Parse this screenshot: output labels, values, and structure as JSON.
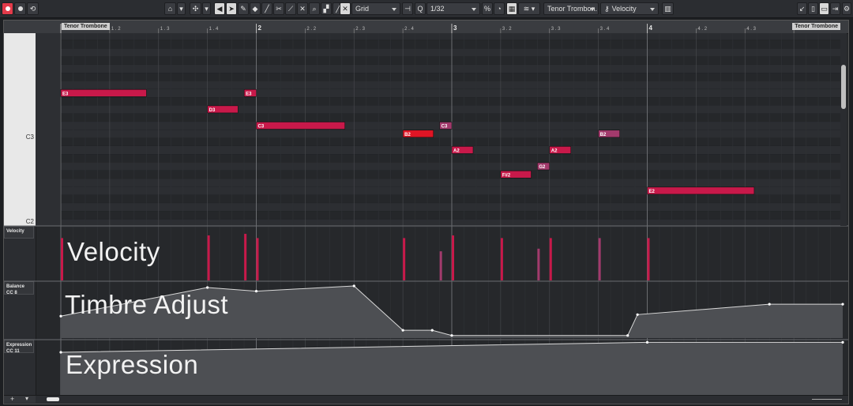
{
  "toolbar": {
    "snap_type": "Grid",
    "quantize": "1/32",
    "track_select": "Tenor Trombon.",
    "lane_select": "Velocity"
  },
  "track_name": "Tenor Trombone",
  "ruler": {
    "bars": [
      "2",
      "3",
      "4"
    ],
    "beats": [
      "1 . 2",
      "1 . 3",
      "1 . 4",
      "2 . 2",
      "2 . 3",
      "2 . 4",
      "3 . 2",
      "3 . 3",
      "3 . 4",
      "4 . 2",
      "4 . 3",
      "4 . 4"
    ]
  },
  "keyboard": {
    "label_c3": "C3",
    "label_c2": "C2"
  },
  "notes": [
    {
      "pitch": "E3",
      "start": 1.0,
      "end": 1.438,
      "velocity": 0.8
    },
    {
      "pitch": "D3",
      "start": 1.75,
      "end": 1.906,
      "velocity": 0.85
    },
    {
      "pitch": "E3",
      "start": 1.938,
      "end": 2.0,
      "velocity": 0.88
    },
    {
      "pitch": "C3",
      "start": 2.0,
      "end": 2.453,
      "velocity": 0.8
    },
    {
      "pitch": "B2",
      "start": 2.75,
      "end": 2.906,
      "velocity": 0.8
    },
    {
      "pitch": "C3",
      "start": 2.938,
      "end": 3.0,
      "velocity": 0.55,
      "muted": true
    },
    {
      "pitch": "A2",
      "start": 3.0,
      "end": 3.109,
      "velocity": 0.85
    },
    {
      "pitch": "F#2",
      "start": 3.25,
      "end": 3.406,
      "velocity": 0.8
    },
    {
      "pitch": "G2",
      "start": 3.438,
      "end": 3.5,
      "velocity": 0.6,
      "muted": true
    },
    {
      "pitch": "A2",
      "start": 3.5,
      "end": 3.609,
      "velocity": 0.8
    },
    {
      "pitch": "B2",
      "start": 3.75,
      "end": 3.859,
      "velocity": 0.8,
      "muted": true
    },
    {
      "pitch": "E2",
      "start": 4.0,
      "end": 4.547,
      "velocity": 0.8
    }
  ],
  "velocity_lane": {
    "label": "Velocity",
    "title": "Velocity"
  },
  "balance_lane": {
    "label": "Balance",
    "sublabel": "CC 8",
    "title": "Timbre Adjust",
    "points": [
      [
        1.0,
        0.58
      ],
      [
        1.75,
        0.03
      ],
      [
        2.0,
        0.1
      ],
      [
        2.5,
        0.0
      ],
      [
        2.75,
        0.85
      ],
      [
        2.9,
        0.85
      ],
      [
        3.0,
        0.95
      ],
      [
        3.9,
        0.95
      ],
      [
        3.95,
        0.55
      ],
      [
        4.625,
        0.35
      ],
      [
        5.0,
        0.35
      ]
    ]
  },
  "expression_lane": {
    "label": "Expression",
    "sublabel": "CC 11",
    "title": "Expression",
    "points": [
      [
        1.0,
        0.2
      ],
      [
        4.0,
        0.02
      ],
      [
        5.0,
        0.02
      ]
    ]
  },
  "colors": {
    "note": "#c8194a",
    "note_muted": "#a23a6c",
    "note_selected": "#e01525",
    "accent": "#e33b4a"
  }
}
